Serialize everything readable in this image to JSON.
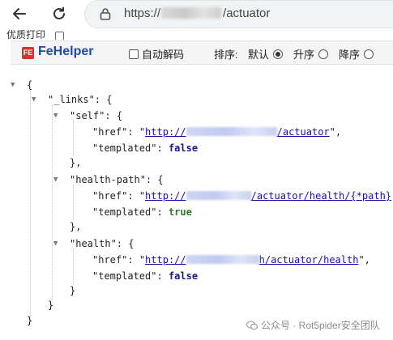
{
  "browser": {
    "url_scheme": "https://",
    "url_path": "/actuator",
    "icons": {
      "back": "back-arrow-icon",
      "reload": "reload-icon",
      "lock": "lock-icon"
    }
  },
  "bookmarks": {
    "item_label": "优质打印"
  },
  "fehelper": {
    "logo_text": "FE",
    "title": "FeHelper",
    "auto_decode_label": "自动解码",
    "sort_label": "排序:",
    "sort_options": [
      "默认",
      "升序",
      "降序"
    ],
    "sort_selected": "默认",
    "auto_decode_checked": false
  },
  "json_view": {
    "open_brace": "{",
    "close_brace": "}",
    "links_key": "\"_links\":",
    "links_open": "{",
    "links_close": "}",
    "entries": [
      {
        "key": "\"self\":",
        "open": "{",
        "href_key": "\"href\":",
        "href_prefix": "\"",
        "href_start": "http://",
        "href_end": "/actuator",
        "href_suffix": "\",",
        "templated_key": "\"templated\":",
        "templated_value": "false",
        "close": "},"
      },
      {
        "key": "\"health-path\":",
        "open": "{",
        "href_key": "\"href\":",
        "href_prefix": "\"",
        "href_start": "http://",
        "href_end": "/actuator/health/{*path}",
        "href_suffix": "\",",
        "templated_key": "\"templated\":",
        "templated_value": "true",
        "close": "},"
      },
      {
        "key": "\"health\":",
        "open": "{",
        "href_key": "\"href\":",
        "href_prefix": "\"",
        "href_start": "http://",
        "href_end": "h/actuator/health",
        "href_suffix": "\",",
        "templated_key": "\"templated\":",
        "templated_value": "false",
        "close": "}"
      }
    ]
  },
  "watermark": {
    "text": "公众号 · Rot5pider安全团队"
  },
  "colors": {
    "fehelper_title": "#1f4aa8",
    "link": "#1a0dab",
    "bool_false": "#1a1a8c",
    "bool_true": "#2a7a2a",
    "logo_red": "#e0302c"
  }
}
